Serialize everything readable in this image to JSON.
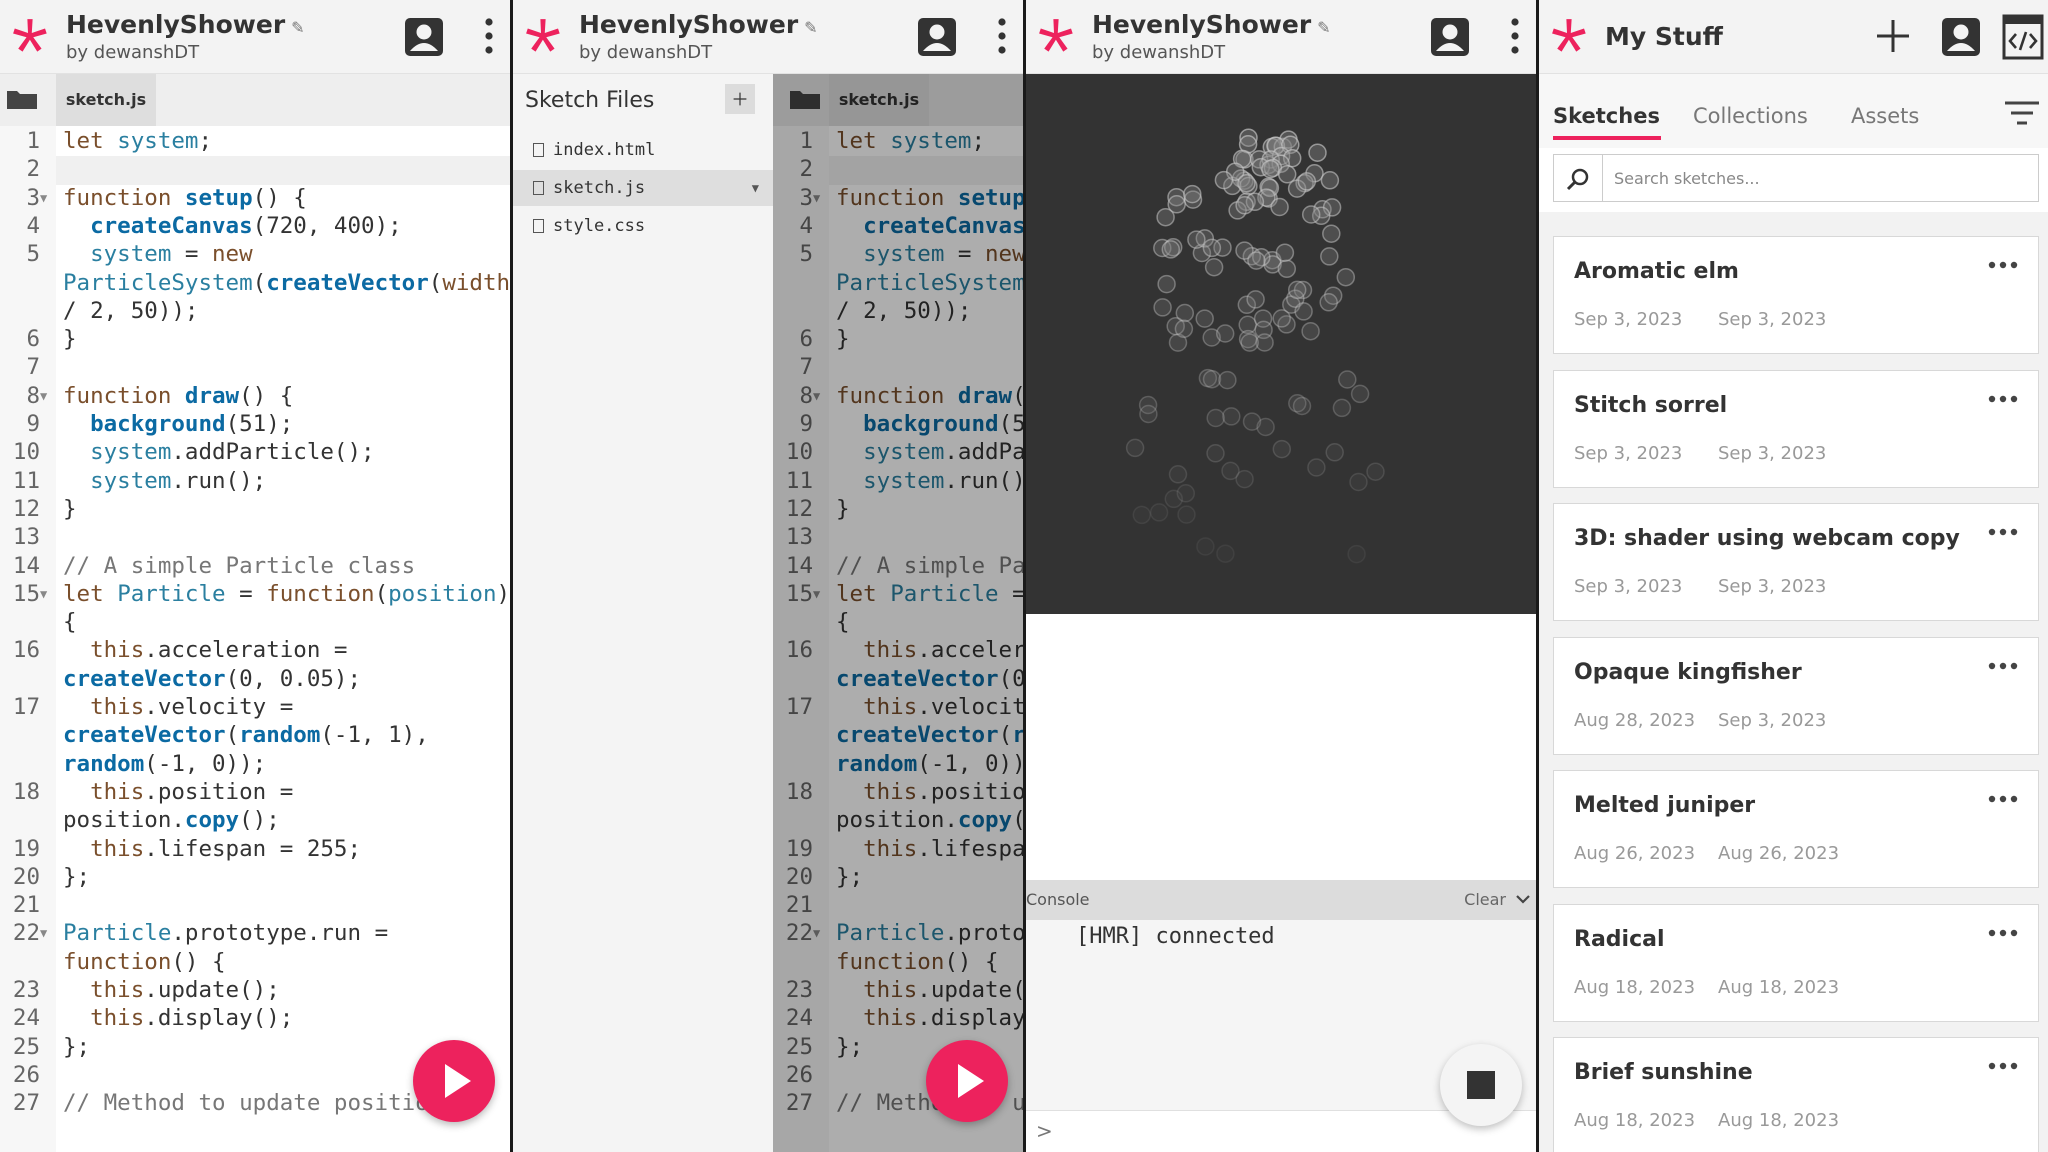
{
  "colors": {
    "accent": "#ed225d",
    "canvas_bg": "#333333",
    "divider": "#1a1a1a"
  },
  "project": {
    "title": "HevenlyShower",
    "owner": "by dewanshDT"
  },
  "icons": {
    "logo": "p5-asterisk-icon",
    "edit": "pencil-icon",
    "account": "avatar-icon",
    "more": "kebab-menu-icon",
    "run": "play-icon",
    "stop": "stop-icon",
    "folder": "folder-icon",
    "add": "plus-icon",
    "file": "file-icon",
    "embed": "code-embed-icon",
    "filter": "filter-icon",
    "search": "search-icon",
    "options": "ellipsis-icon",
    "collapse": "chevron-down-icon"
  },
  "editor": {
    "tab_label": "sketch.js",
    "lines": [
      {
        "n": "1",
        "fold": false,
        "wrap": [
          [
            "let ",
            "kw"
          ],
          [
            "system",
            "vr"
          ],
          [
            ";",
            "nm"
          ]
        ]
      },
      {
        "n": "2",
        "fold": false,
        "wrap": []
      },
      {
        "n": "3",
        "fold": true,
        "wrap": [
          [
            "function ",
            "kw"
          ],
          [
            "setup",
            "fn"
          ],
          [
            "() {",
            "nm"
          ]
        ]
      },
      {
        "n": "4",
        "fold": false,
        "wrap": [
          [
            "  ",
            "nm"
          ],
          [
            "createCanvas",
            "fn"
          ],
          [
            "(720, 400);",
            "nm"
          ]
        ]
      },
      {
        "n": "5",
        "fold": false,
        "wrap": [
          [
            "  ",
            "nm"
          ],
          [
            "system",
            "vr"
          ],
          [
            " = ",
            "nm"
          ],
          [
            "new",
            "kw"
          ]
        ],
        "extra": [
          [
            [
              "ParticleSystem",
              "vr"
            ],
            [
              "(",
              "nm"
            ],
            [
              "createVector",
              "fn"
            ],
            [
              "(",
              "nm"
            ],
            [
              "width",
              "kw"
            ]
          ],
          [
            [
              "/ 2, 50));",
              "nm"
            ]
          ]
        ]
      },
      {
        "n": "6",
        "fold": false,
        "wrap": [
          [
            "}",
            "nm"
          ]
        ]
      },
      {
        "n": "7",
        "fold": false,
        "wrap": []
      },
      {
        "n": "8",
        "fold": true,
        "wrap": [
          [
            "function ",
            "kw"
          ],
          [
            "draw",
            "fn"
          ],
          [
            "() {",
            "nm"
          ]
        ]
      },
      {
        "n": "9",
        "fold": false,
        "wrap": [
          [
            "  ",
            "nm"
          ],
          [
            "background",
            "fn"
          ],
          [
            "(51);",
            "nm"
          ]
        ]
      },
      {
        "n": "10",
        "fold": false,
        "wrap": [
          [
            "  ",
            "nm"
          ],
          [
            "system",
            "vr"
          ],
          [
            ".addParticle();",
            "nm"
          ]
        ]
      },
      {
        "n": "11",
        "fold": false,
        "wrap": [
          [
            "  ",
            "nm"
          ],
          [
            "system",
            "vr"
          ],
          [
            ".run();",
            "nm"
          ]
        ]
      },
      {
        "n": "12",
        "fold": false,
        "wrap": [
          [
            "}",
            "nm"
          ]
        ]
      },
      {
        "n": "13",
        "fold": false,
        "wrap": []
      },
      {
        "n": "14",
        "fold": false,
        "wrap": [
          [
            "// A simple Particle class",
            "cm"
          ]
        ]
      },
      {
        "n": "15",
        "fold": true,
        "wrap": [
          [
            "let ",
            "kw"
          ],
          [
            "Particle",
            "vr"
          ],
          [
            " = ",
            "nm"
          ],
          [
            "function",
            "kw"
          ],
          [
            "(",
            "nm"
          ],
          [
            "position",
            "vr"
          ],
          [
            ")",
            "nm"
          ]
        ],
        "extra": [
          [
            [
              "{",
              "nm"
            ]
          ]
        ]
      },
      {
        "n": "16",
        "fold": false,
        "wrap": [
          [
            "  ",
            "nm"
          ],
          [
            "this",
            "kw"
          ],
          [
            ".acceleration =",
            "nm"
          ]
        ],
        "extra": [
          [
            [
              "createVector",
              "fn"
            ],
            [
              "(0, 0.05);",
              "nm"
            ]
          ]
        ]
      },
      {
        "n": "17",
        "fold": false,
        "wrap": [
          [
            "  ",
            "nm"
          ],
          [
            "this",
            "kw"
          ],
          [
            ".velocity =",
            "nm"
          ]
        ],
        "extra": [
          [
            [
              "createVector",
              "fn"
            ],
            [
              "(",
              "nm"
            ],
            [
              "random",
              "fn"
            ],
            [
              "(-1, 1),",
              "nm"
            ]
          ],
          [
            [
              "random",
              "fn"
            ],
            [
              "(-1, 0));",
              "nm"
            ]
          ]
        ]
      },
      {
        "n": "18",
        "fold": false,
        "wrap": [
          [
            "  ",
            "nm"
          ],
          [
            "this",
            "kw"
          ],
          [
            ".position =",
            "nm"
          ]
        ],
        "extra": [
          [
            [
              "position.",
              "nm"
            ],
            [
              "copy",
              "fn"
            ],
            [
              "();",
              "nm"
            ]
          ]
        ]
      },
      {
        "n": "19",
        "fold": false,
        "wrap": [
          [
            "  ",
            "nm"
          ],
          [
            "this",
            "kw"
          ],
          [
            ".lifespan = 255;",
            "nm"
          ]
        ]
      },
      {
        "n": "20",
        "fold": false,
        "wrap": [
          [
            "};",
            "nm"
          ]
        ]
      },
      {
        "n": "21",
        "fold": false,
        "wrap": []
      },
      {
        "n": "22",
        "fold": true,
        "wrap": [
          [
            "Particle",
            "vr"
          ],
          [
            ".prototype.run =",
            "nm"
          ]
        ],
        "extra": [
          [
            [
              "function",
              "kw"
            ],
            [
              "() {",
              "nm"
            ]
          ]
        ]
      },
      {
        "n": "23",
        "fold": false,
        "wrap": [
          [
            "  ",
            "nm"
          ],
          [
            "this",
            "kw"
          ],
          [
            ".update();",
            "nm"
          ]
        ]
      },
      {
        "n": "24",
        "fold": false,
        "wrap": [
          [
            "  ",
            "nm"
          ],
          [
            "this",
            "kw"
          ],
          [
            ".display();",
            "nm"
          ]
        ]
      },
      {
        "n": "25",
        "fold": false,
        "wrap": [
          [
            "};",
            "nm"
          ]
        ]
      },
      {
        "n": "26",
        "fold": false,
        "wrap": []
      },
      {
        "n": "27",
        "fold": false,
        "wrap": [
          [
            "// Method to update position",
            "cm"
          ]
        ]
      }
    ]
  },
  "sidebar": {
    "heading": "Sketch Files",
    "files": [
      "index.html",
      "sketch.js",
      "style.css"
    ],
    "selected_file": "sketch.js"
  },
  "console": {
    "label": "Console",
    "clear_label": "Clear",
    "message": "[HMR] connected",
    "prompt": ">"
  },
  "my_stuff": {
    "title": "My Stuff",
    "tabs": [
      "Sketches",
      "Collections",
      "Assets"
    ],
    "active_tab": "Sketches",
    "search_placeholder": "Search sketches...",
    "sketches": [
      {
        "name": "Aromatic elm",
        "created": "Sep 3, 2023",
        "updated": "Sep 3, 2023"
      },
      {
        "name": "Stitch sorrel",
        "created": "Sep 3, 2023",
        "updated": "Sep 3, 2023"
      },
      {
        "name": "3D: shader using webcam copy",
        "created": "Sep 3, 2023",
        "updated": "Sep 3, 2023"
      },
      {
        "name": "Opaque kingfisher",
        "created": "Aug 28, 2023",
        "updated": "Sep 3, 2023"
      },
      {
        "name": "Melted juniper",
        "created": "Aug 26, 2023",
        "updated": "Aug 26, 2023"
      },
      {
        "name": "Radical",
        "created": "Aug 18, 2023",
        "updated": "Aug 18, 2023"
      },
      {
        "name": "Brief sunshine",
        "created": "Aug 18, 2023",
        "updated": "Aug 18, 2023"
      }
    ]
  }
}
